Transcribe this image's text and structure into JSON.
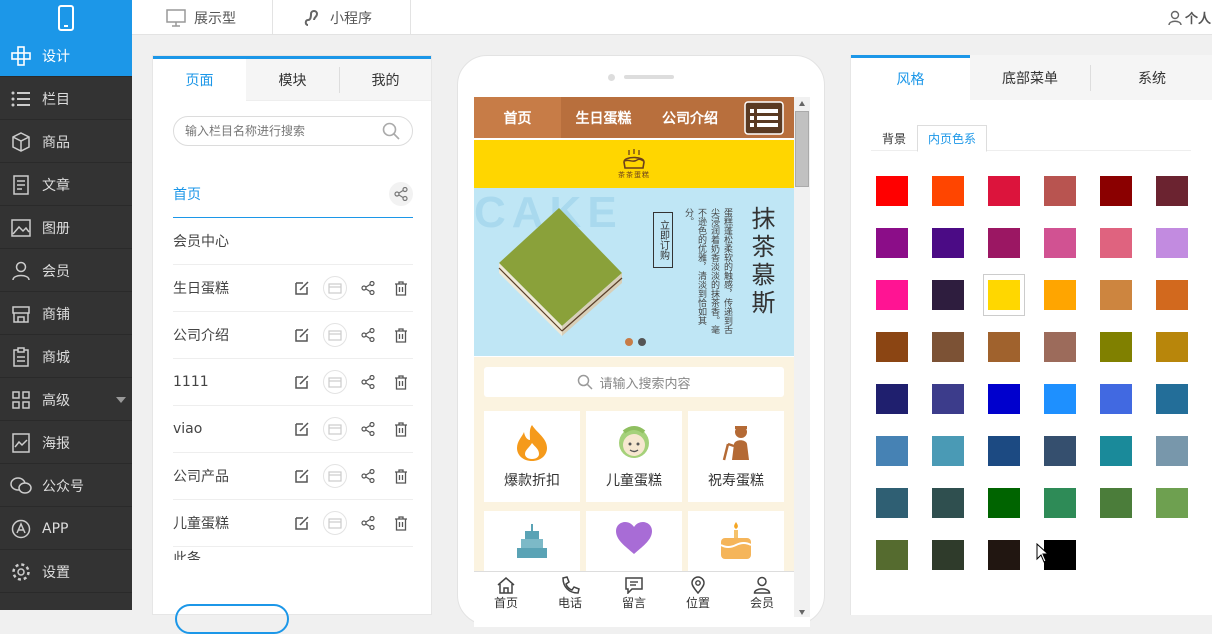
{
  "nav": {
    "items": [
      {
        "label": "设计",
        "icon": "design-icon"
      },
      {
        "label": "栏目",
        "icon": "list-icon"
      },
      {
        "label": "商品",
        "icon": "cube-icon"
      },
      {
        "label": "文章",
        "icon": "article-icon"
      },
      {
        "label": "图册",
        "icon": "image-icon"
      },
      {
        "label": "会员",
        "icon": "user-icon"
      },
      {
        "label": "商铺",
        "icon": "shop-icon"
      },
      {
        "label": "商城",
        "icon": "mall-icon"
      },
      {
        "label": "高级",
        "icon": "grid-icon"
      },
      {
        "label": "海报",
        "icon": "poster-icon"
      },
      {
        "label": "公众号",
        "icon": "wechat-icon"
      },
      {
        "label": "APP",
        "icon": "app-icon"
      },
      {
        "label": "设置",
        "icon": "gear-icon"
      }
    ]
  },
  "topbar": {
    "display_label": "展示型",
    "miniprogram_label": "小程序",
    "user_label": "个人"
  },
  "left_panel": {
    "tabs": [
      "页面",
      "模块",
      "我的"
    ],
    "search_placeholder": "输入栏目名称进行搜索",
    "pages": [
      {
        "name": "首页"
      },
      {
        "name": "会员中心"
      },
      {
        "name": "生日蛋糕"
      },
      {
        "name": "公司介绍"
      },
      {
        "name": "1111"
      },
      {
        "name": "viao"
      },
      {
        "name": "公司产品"
      },
      {
        "name": "儿童蛋糕"
      },
      {
        "name": "此条"
      }
    ]
  },
  "phone": {
    "menu": [
      "首页",
      "生日蛋糕",
      "公司介绍"
    ],
    "logo_text": "茶茶蛋糕",
    "banner": {
      "bg_word": "CAKE",
      "title": "抹茶慕斯",
      "button": "立即订购",
      "desc": "蛋糕蓬松柔软的触感，传递到舌尖浸润着奶香淡淡的抹茶香。毫不逊色的优雅，清淡到恰如其分。"
    },
    "search_placeholder": "请输入搜索内容",
    "categories": [
      {
        "label": "爆款折扣",
        "icon": "fire-icon"
      },
      {
        "label": "儿童蛋糕",
        "icon": "child-icon"
      },
      {
        "label": "祝寿蛋糕",
        "icon": "elder-icon"
      }
    ],
    "footer": [
      {
        "label": "首页",
        "icon": "home-icon"
      },
      {
        "label": "电话",
        "icon": "phone-icon"
      },
      {
        "label": "留言",
        "icon": "message-icon"
      },
      {
        "label": "位置",
        "icon": "location-icon"
      },
      {
        "label": "会员",
        "icon": "member-icon"
      }
    ]
  },
  "right_panel": {
    "tabs": [
      "风格",
      "底部菜单",
      "系统"
    ],
    "subtabs": [
      "背景",
      "内页色系"
    ],
    "selected_swatch": 14,
    "swatches": [
      "#ff0000",
      "#ff4500",
      "#dc143c",
      "#b85450",
      "#8b0000",
      "#6b2330",
      "#8b0d88",
      "#4b0b85",
      "#9b1763",
      "#d15292",
      "#df637f",
      "#c28be0",
      "#ff1493",
      "#2e1d3e",
      "#ffd700",
      "#ffa500",
      "#cd853f",
      "#d2691e",
      "#8b4513",
      "#7c5235",
      "#a0622d",
      "#9c6b5b",
      "#808000",
      "#b8860b",
      "#1f1f6e",
      "#3c3c8b",
      "#0000cd",
      "#1e90ff",
      "#4169e1",
      "#236e99",
      "#4682b4",
      "#4a9ab5",
      "#1c4a82",
      "#354f6e",
      "#1a8a9a",
      "#7897ab",
      "#2f5f73",
      "#2f4f4f",
      "#006400",
      "#2e8b57",
      "#4b7d3a",
      "#6ea050",
      "#556b2f",
      "#2f3b2b",
      "#211611",
      "#000000"
    ]
  },
  "colors": {
    "accent": "#1c97e8",
    "nav_bg": "#333333",
    "phone_menu_bg": "#c77c47",
    "phone_logo_bg": "#ffd600",
    "banner_bg": "#bfe6f5"
  }
}
